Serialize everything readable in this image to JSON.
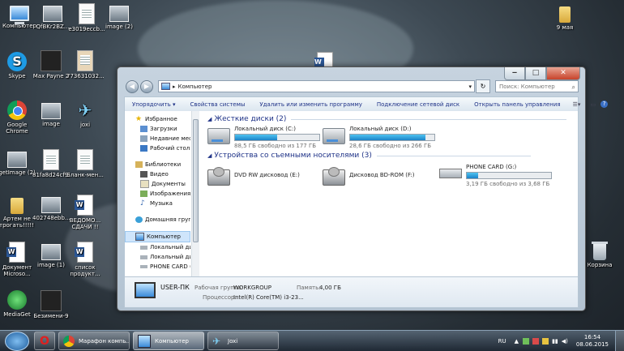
{
  "desktop": {
    "icons": [
      {
        "label": "Компьютер"
      },
      {
        "label": "QfBKr2BZ..."
      },
      {
        "label": "e3019eccb..."
      },
      {
        "label": "image (2)"
      },
      {
        "label": "9 мая"
      },
      {
        "label": "Skype"
      },
      {
        "label": "Max Payne 2"
      },
      {
        "label": "773631032..."
      },
      {
        "label": "Google Chrome"
      },
      {
        "label": "image"
      },
      {
        "label": "joxi"
      },
      {
        "label": "getImage (2)"
      },
      {
        "label": "81fa8d24cf99"
      },
      {
        "label": "Бланк-мен..."
      },
      {
        "label": "Артем не трогать!!!!!!!!!"
      },
      {
        "label": "402748ebb..."
      },
      {
        "label": "ВЕДОМО... СДАЧИ !!"
      },
      {
        "label": "Документ Microso..."
      },
      {
        "label": "image (1)"
      },
      {
        "label": "список продукт..."
      },
      {
        "label": "Корзина"
      },
      {
        "label": "MediaGet"
      },
      {
        "label": "Безимени-9"
      }
    ]
  },
  "window": {
    "address": {
      "path": "Компьютер",
      "separator": "▸"
    },
    "search_placeholder": "Поиск: Компьютер",
    "toolbar": {
      "organize": "Упорядочить ▾",
      "properties": "Свойства системы",
      "uninstall": "Удалить или изменить программу",
      "map_drive": "Подключение сетевой диск",
      "control_panel": "Открыть панель управления"
    },
    "nav": {
      "favorites": "Избранное",
      "downloads": "Загрузки",
      "recent": "Недавние места",
      "desktop": "Рабочий стол",
      "libraries": "Библиотеки",
      "video": "Видео",
      "documents": "Документы",
      "images": "Изображения",
      "music": "Музыка",
      "homegroup": "Домашняя группа",
      "computer": "Компьютер",
      "local1": "Локальный диск",
      "local2": "Локальный диск",
      "phone": "PHONE CARD (G"
    },
    "groups": {
      "hdd": "Жесткие диски (2)",
      "removable": "Устройства со съемными носителями (3)"
    },
    "drives": {
      "c": {
        "name": "Локальный диск (C:)",
        "free": "88,5 ГБ свободно из 177 ГБ",
        "used_fraction": 0.5
      },
      "d": {
        "name": "Локальный диск (D:)",
        "free": "28,6 ГБ свободно из 266 ГБ",
        "used_fraction": 0.89
      },
      "e": {
        "name": "DVD RW дисковод (E:)"
      },
      "f": {
        "name": "Дисковод BD-ROM (F:)"
      },
      "g": {
        "name": "PHONE CARD (G:)",
        "free": "3,19 ГБ свободно из 3,68 ГБ",
        "used_fraction": 0.13
      }
    },
    "details": {
      "name": "USER-ПК",
      "workgroup_label": "Рабочая группа:",
      "workgroup": "WORKGROUP",
      "memory_label": "Память:",
      "memory": "4,00 ГБ",
      "cpu_label": "Процессор:",
      "cpu": "Intel(R) Core(TM) i3-23..."
    }
  },
  "taskbar": {
    "items": [
      {
        "label": "Марафон компь..."
      },
      {
        "label": "Компьютер"
      },
      {
        "label": "Joxi"
      }
    ],
    "lang": "RU",
    "time": "16:54",
    "date": "08.06.2015"
  }
}
